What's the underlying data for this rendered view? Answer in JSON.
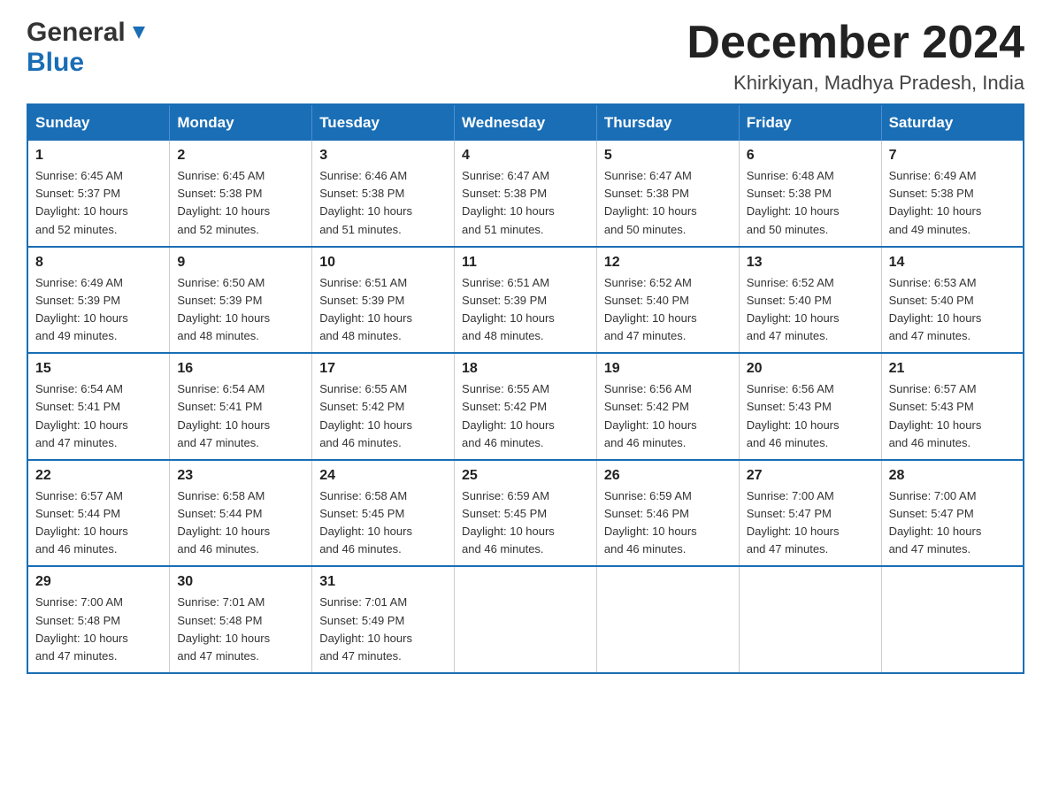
{
  "header": {
    "logo_general": "General",
    "logo_blue": "Blue",
    "month_title": "December 2024",
    "location": "Khirkiyan, Madhya Pradesh, India"
  },
  "calendar": {
    "days_of_week": [
      "Sunday",
      "Monday",
      "Tuesday",
      "Wednesday",
      "Thursday",
      "Friday",
      "Saturday"
    ],
    "weeks": [
      [
        {
          "day": "1",
          "info": "Sunrise: 6:45 AM\nSunset: 5:37 PM\nDaylight: 10 hours\nand 52 minutes."
        },
        {
          "day": "2",
          "info": "Sunrise: 6:45 AM\nSunset: 5:38 PM\nDaylight: 10 hours\nand 52 minutes."
        },
        {
          "day": "3",
          "info": "Sunrise: 6:46 AM\nSunset: 5:38 PM\nDaylight: 10 hours\nand 51 minutes."
        },
        {
          "day": "4",
          "info": "Sunrise: 6:47 AM\nSunset: 5:38 PM\nDaylight: 10 hours\nand 51 minutes."
        },
        {
          "day": "5",
          "info": "Sunrise: 6:47 AM\nSunset: 5:38 PM\nDaylight: 10 hours\nand 50 minutes."
        },
        {
          "day": "6",
          "info": "Sunrise: 6:48 AM\nSunset: 5:38 PM\nDaylight: 10 hours\nand 50 minutes."
        },
        {
          "day": "7",
          "info": "Sunrise: 6:49 AM\nSunset: 5:38 PM\nDaylight: 10 hours\nand 49 minutes."
        }
      ],
      [
        {
          "day": "8",
          "info": "Sunrise: 6:49 AM\nSunset: 5:39 PM\nDaylight: 10 hours\nand 49 minutes."
        },
        {
          "day": "9",
          "info": "Sunrise: 6:50 AM\nSunset: 5:39 PM\nDaylight: 10 hours\nand 48 minutes."
        },
        {
          "day": "10",
          "info": "Sunrise: 6:51 AM\nSunset: 5:39 PM\nDaylight: 10 hours\nand 48 minutes."
        },
        {
          "day": "11",
          "info": "Sunrise: 6:51 AM\nSunset: 5:39 PM\nDaylight: 10 hours\nand 48 minutes."
        },
        {
          "day": "12",
          "info": "Sunrise: 6:52 AM\nSunset: 5:40 PM\nDaylight: 10 hours\nand 47 minutes."
        },
        {
          "day": "13",
          "info": "Sunrise: 6:52 AM\nSunset: 5:40 PM\nDaylight: 10 hours\nand 47 minutes."
        },
        {
          "day": "14",
          "info": "Sunrise: 6:53 AM\nSunset: 5:40 PM\nDaylight: 10 hours\nand 47 minutes."
        }
      ],
      [
        {
          "day": "15",
          "info": "Sunrise: 6:54 AM\nSunset: 5:41 PM\nDaylight: 10 hours\nand 47 minutes."
        },
        {
          "day": "16",
          "info": "Sunrise: 6:54 AM\nSunset: 5:41 PM\nDaylight: 10 hours\nand 47 minutes."
        },
        {
          "day": "17",
          "info": "Sunrise: 6:55 AM\nSunset: 5:42 PM\nDaylight: 10 hours\nand 46 minutes."
        },
        {
          "day": "18",
          "info": "Sunrise: 6:55 AM\nSunset: 5:42 PM\nDaylight: 10 hours\nand 46 minutes."
        },
        {
          "day": "19",
          "info": "Sunrise: 6:56 AM\nSunset: 5:42 PM\nDaylight: 10 hours\nand 46 minutes."
        },
        {
          "day": "20",
          "info": "Sunrise: 6:56 AM\nSunset: 5:43 PM\nDaylight: 10 hours\nand 46 minutes."
        },
        {
          "day": "21",
          "info": "Sunrise: 6:57 AM\nSunset: 5:43 PM\nDaylight: 10 hours\nand 46 minutes."
        }
      ],
      [
        {
          "day": "22",
          "info": "Sunrise: 6:57 AM\nSunset: 5:44 PM\nDaylight: 10 hours\nand 46 minutes."
        },
        {
          "day": "23",
          "info": "Sunrise: 6:58 AM\nSunset: 5:44 PM\nDaylight: 10 hours\nand 46 minutes."
        },
        {
          "day": "24",
          "info": "Sunrise: 6:58 AM\nSunset: 5:45 PM\nDaylight: 10 hours\nand 46 minutes."
        },
        {
          "day": "25",
          "info": "Sunrise: 6:59 AM\nSunset: 5:45 PM\nDaylight: 10 hours\nand 46 minutes."
        },
        {
          "day": "26",
          "info": "Sunrise: 6:59 AM\nSunset: 5:46 PM\nDaylight: 10 hours\nand 46 minutes."
        },
        {
          "day": "27",
          "info": "Sunrise: 7:00 AM\nSunset: 5:47 PM\nDaylight: 10 hours\nand 47 minutes."
        },
        {
          "day": "28",
          "info": "Sunrise: 7:00 AM\nSunset: 5:47 PM\nDaylight: 10 hours\nand 47 minutes."
        }
      ],
      [
        {
          "day": "29",
          "info": "Sunrise: 7:00 AM\nSunset: 5:48 PM\nDaylight: 10 hours\nand 47 minutes."
        },
        {
          "day": "30",
          "info": "Sunrise: 7:01 AM\nSunset: 5:48 PM\nDaylight: 10 hours\nand 47 minutes."
        },
        {
          "day": "31",
          "info": "Sunrise: 7:01 AM\nSunset: 5:49 PM\nDaylight: 10 hours\nand 47 minutes."
        },
        {
          "day": "",
          "info": ""
        },
        {
          "day": "",
          "info": ""
        },
        {
          "day": "",
          "info": ""
        },
        {
          "day": "",
          "info": ""
        }
      ]
    ]
  }
}
